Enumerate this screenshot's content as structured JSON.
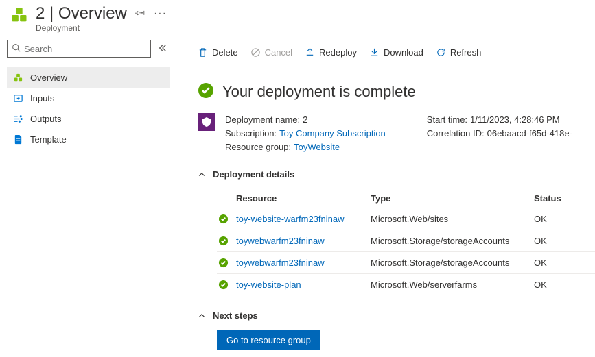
{
  "header": {
    "title": "2 | Overview",
    "subtitle": "Deployment"
  },
  "sidebar": {
    "search_placeholder": "Search",
    "items": [
      {
        "label": "Overview",
        "icon": "deployment",
        "selected": true
      },
      {
        "label": "Inputs",
        "icon": "inputs",
        "selected": false
      },
      {
        "label": "Outputs",
        "icon": "outputs",
        "selected": false
      },
      {
        "label": "Template",
        "icon": "template",
        "selected": false
      }
    ]
  },
  "toolbar": {
    "delete": "Delete",
    "cancel": "Cancel",
    "redeploy": "Redeploy",
    "download": "Download",
    "refresh": "Refresh"
  },
  "status": {
    "heading": "Your deployment is complete"
  },
  "details": {
    "deployment_name_label": "Deployment name:",
    "deployment_name": "2",
    "subscription_label": "Subscription:",
    "subscription": "Toy Company Subscription",
    "resource_group_label": "Resource group:",
    "resource_group": "ToyWebsite",
    "start_time_label": "Start time:",
    "start_time": "1/11/2023, 4:28:46 PM",
    "correlation_id_label": "Correlation ID:",
    "correlation_id": "06ebaacd-f65d-418e-"
  },
  "deployment_details": {
    "heading": "Deployment details",
    "columns": {
      "resource": "Resource",
      "type": "Type",
      "status": "Status"
    },
    "rows": [
      {
        "resource": "toy-website-warfm23fninaw",
        "type": "Microsoft.Web/sites",
        "status": "OK"
      },
      {
        "resource": "toywebwarfm23fninaw",
        "type": "Microsoft.Storage/storageAccounts",
        "status": "OK"
      },
      {
        "resource": "toywebwarfm23fninaw",
        "type": "Microsoft.Storage/storageAccounts",
        "status": "OK"
      },
      {
        "resource": "toy-website-plan",
        "type": "Microsoft.Web/serverfarms",
        "status": "OK"
      }
    ]
  },
  "next_steps": {
    "heading": "Next steps",
    "button": "Go to resource group"
  }
}
